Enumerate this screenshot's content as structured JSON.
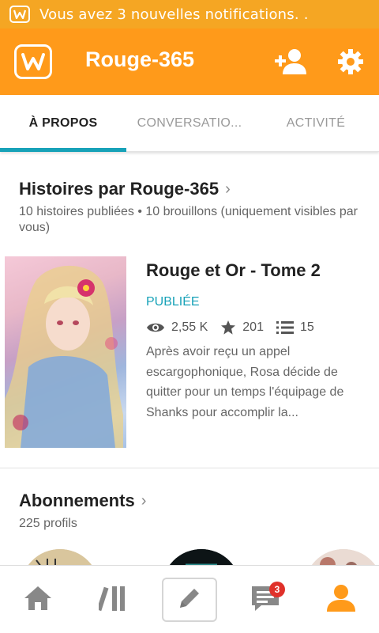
{
  "status_bar": {
    "notification_text": "Vous avez 3 nouvelles notifications.   .",
    "icon": "wattpad-w-icon"
  },
  "app_bar": {
    "title": "Rouge-365",
    "icons": [
      "wattpad-logo-icon",
      "add-user-icon",
      "gear-icon"
    ]
  },
  "tabs": [
    {
      "label": "À PROPOS",
      "active": true
    },
    {
      "label": "CONVERSATIO...",
      "active": false
    },
    {
      "label": "ACTIVITÉ",
      "active": false
    }
  ],
  "stories_section": {
    "title": "Histoires par Rouge-365",
    "subtitle": "10 histoires publiées • 10 brouillons (uniquement visibles par vous)",
    "story": {
      "title": "Rouge et Or - Tome 2",
      "status": "PUBLIÉE",
      "reads": "2,55 K",
      "votes": "201",
      "parts": "15",
      "description": "Après avoir reçu un appel escargophonique, Rosa décide de quitter pour un temps l'équipage de Shanks pour accomplir la..."
    }
  },
  "subscriptions_section": {
    "title": "Abonnements",
    "subtitle": "225 profils"
  },
  "bottom_nav": {
    "items": [
      "home-icon",
      "library-icon",
      "pencil-icon",
      "messages-icon",
      "profile-icon"
    ],
    "messages_badge": "3"
  },
  "colors": {
    "status_bar": "#f5a623",
    "app_bar": "#ff9a1a",
    "accent": "#17a2b8",
    "badge": "#e0312a",
    "active_nav": "#ff9a1a"
  }
}
